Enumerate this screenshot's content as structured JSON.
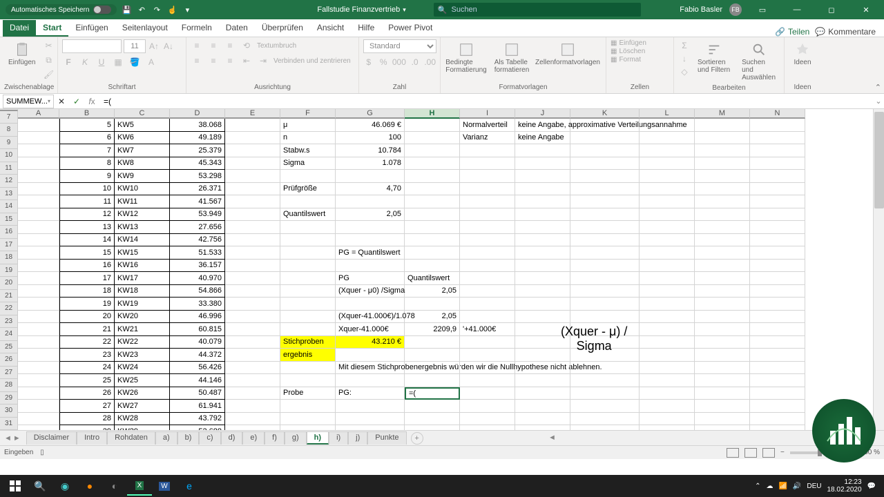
{
  "titlebar": {
    "autosave": "Automatisches Speichern",
    "filename": "Fallstudie Finanzvertrieb",
    "search_placeholder": "Suchen",
    "user": "Fabio Basler",
    "user_initials": "FB"
  },
  "tabs": {
    "file": "Datei",
    "home": "Start",
    "insert": "Einfügen",
    "layout": "Seitenlayout",
    "formulas": "Formeln",
    "data": "Daten",
    "review": "Überprüfen",
    "view": "Ansicht",
    "help": "Hilfe",
    "pivot": "Power Pivot",
    "share": "Teilen",
    "comments": "Kommentare"
  },
  "ribbon": {
    "clipboard": {
      "label": "Zwischenablage",
      "paste": "Einfügen"
    },
    "font": {
      "label": "Schriftart",
      "size": "11"
    },
    "align": {
      "label": "Ausrichtung",
      "wrap": "Textumbruch",
      "merge": "Verbinden und zentrieren"
    },
    "number": {
      "label": "Zahl",
      "format": "Standard"
    },
    "styles": {
      "label": "Formatvorlagen",
      "cond": "Bedingte Formatierung",
      "table": "Als Tabelle formatieren",
      "cell": "Zellenformatvorlagen"
    },
    "cells": {
      "label": "Zellen",
      "insert": "Einfügen",
      "delete": "Löschen",
      "format": "Format"
    },
    "edit": {
      "label": "Bearbeiten",
      "sort": "Sortieren und Filtern",
      "find": "Suchen und Auswählen"
    },
    "ideas": {
      "label": "Ideen",
      "btn": "Ideen"
    }
  },
  "formula": {
    "name": "SUMMEW...",
    "value": "=("
  },
  "cols": {
    "A": 60,
    "B": 80,
    "C": 80,
    "D": 80,
    "E": 80,
    "F": 80,
    "G": 100,
    "H": 80,
    "I": 80,
    "J": 80,
    "K": 100,
    "L": 80,
    "M": 80,
    "N": 80
  },
  "rows": [
    7,
    8,
    9,
    10,
    11,
    12,
    13,
    14,
    15,
    16,
    17,
    18,
    19,
    20,
    21,
    22,
    23,
    24,
    25,
    26,
    27,
    28,
    29,
    30,
    31
  ],
  "data": {
    "B": [
      "5",
      "6",
      "7",
      "8",
      "9",
      "10",
      "11",
      "12",
      "13",
      "14",
      "15",
      "16",
      "17",
      "18",
      "19",
      "20",
      "21",
      "22",
      "23",
      "24",
      "25",
      "26",
      "27",
      "28",
      "29"
    ],
    "C": [
      "KW5",
      "KW6",
      "KW7",
      "KW8",
      "KW9",
      "KW10",
      "KW11",
      "KW12",
      "KW13",
      "KW14",
      "KW15",
      "KW16",
      "KW17",
      "KW18",
      "KW19",
      "KW20",
      "KW21",
      "KW22",
      "KW23",
      "KW24",
      "KW25",
      "KW26",
      "KW27",
      "KW28",
      "KW29"
    ],
    "D": [
      "38.068",
      "49.189",
      "25.379",
      "45.343",
      "53.298",
      "26.371",
      "41.567",
      "53.949",
      "27.656",
      "42.756",
      "51.533",
      "36.157",
      "40.970",
      "54.866",
      "33.380",
      "46.996",
      "60.815",
      "40.079",
      "44.372",
      "56.426",
      "44.146",
      "50.487",
      "61.941",
      "43.792",
      "52.688"
    ]
  },
  "F": {
    "7": "μ",
    "8": "n",
    "9": "Stabw.s",
    "10": "Sigma",
    "12": "Prüfgröße",
    "14": "Quantilswert",
    "24": "Stichproben",
    "25": "ergebnis",
    "28": "Probe"
  },
  "G": {
    "7": "46.069 €",
    "8": "100",
    "9": "10.784",
    "10": "1.078",
    "12": "4,70",
    "14": "2,05",
    "17": "PG = Quantilswert",
    "19": "PG",
    "20": "(Xquer - μ0) /Sigma",
    "22": "(Xquer-41.000€)/1.078",
    "23": "Xquer-41.000€",
    "24": "43.210 €",
    "26": "Mit diesem Stichprobenergebnis würden wir die Nullhypothese nicht ablehnen.",
    "28": "PG:"
  },
  "H": {
    "19": "Quantilswert",
    "20": "2,05",
    "22": "2,05",
    "23": "2209,9"
  },
  "I": {
    "7": "Normalverteil",
    "8": "Varianz",
    "23": "'+41.000€"
  },
  "J": {
    "7": "keine Angabe, approximative Verteilungsannahme",
    "8": "keine Angabe"
  },
  "annotation": {
    "line1": "(Xquer - μ) /",
    "line2": "Sigma"
  },
  "edit_value": "=(",
  "sheets": [
    "Disclaimer",
    "Intro",
    "Rohdaten",
    "a)",
    "b)",
    "c)",
    "d)",
    "e)",
    "f)",
    "g)",
    "h)",
    "i)",
    "j)",
    "Punkte"
  ],
  "active_sheet": "h)",
  "status": "Eingeben",
  "zoom": "100 %",
  "clock": {
    "time": "12:23",
    "date": "18.02.2020"
  }
}
